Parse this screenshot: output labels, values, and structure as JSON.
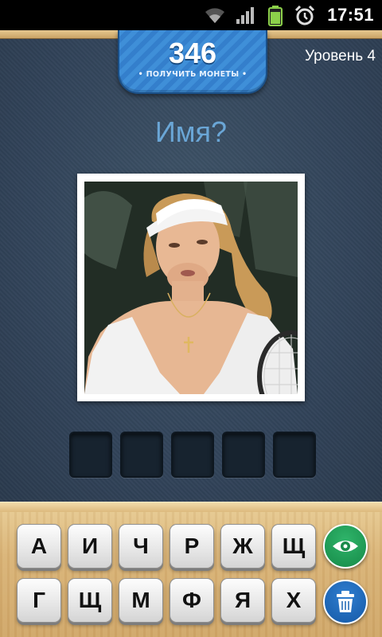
{
  "status_bar": {
    "time": "17:51"
  },
  "header": {
    "coins": "346",
    "coins_label": "• ПОЛУЧИТЬ МОНЕТЫ •",
    "level": "Уровень 4"
  },
  "question": "Имя?",
  "answer": {
    "slot_count": 5,
    "letters": [
      "",
      "",
      "",
      "",
      ""
    ]
  },
  "keyboard": {
    "row1": [
      "А",
      "И",
      "Ч",
      "Р",
      "Ж",
      "Щ"
    ],
    "row2": [
      "Г",
      "Щ",
      "М",
      "Ф",
      "Я",
      "Х"
    ],
    "reveal_icon": "eye-icon",
    "remove_icon": "trash-icon"
  },
  "colors": {
    "coin_badge": "#3f8fd8",
    "question_text": "#6aa6d6",
    "reveal_button": "#1f9e57",
    "remove_button": "#1f6bbd"
  }
}
